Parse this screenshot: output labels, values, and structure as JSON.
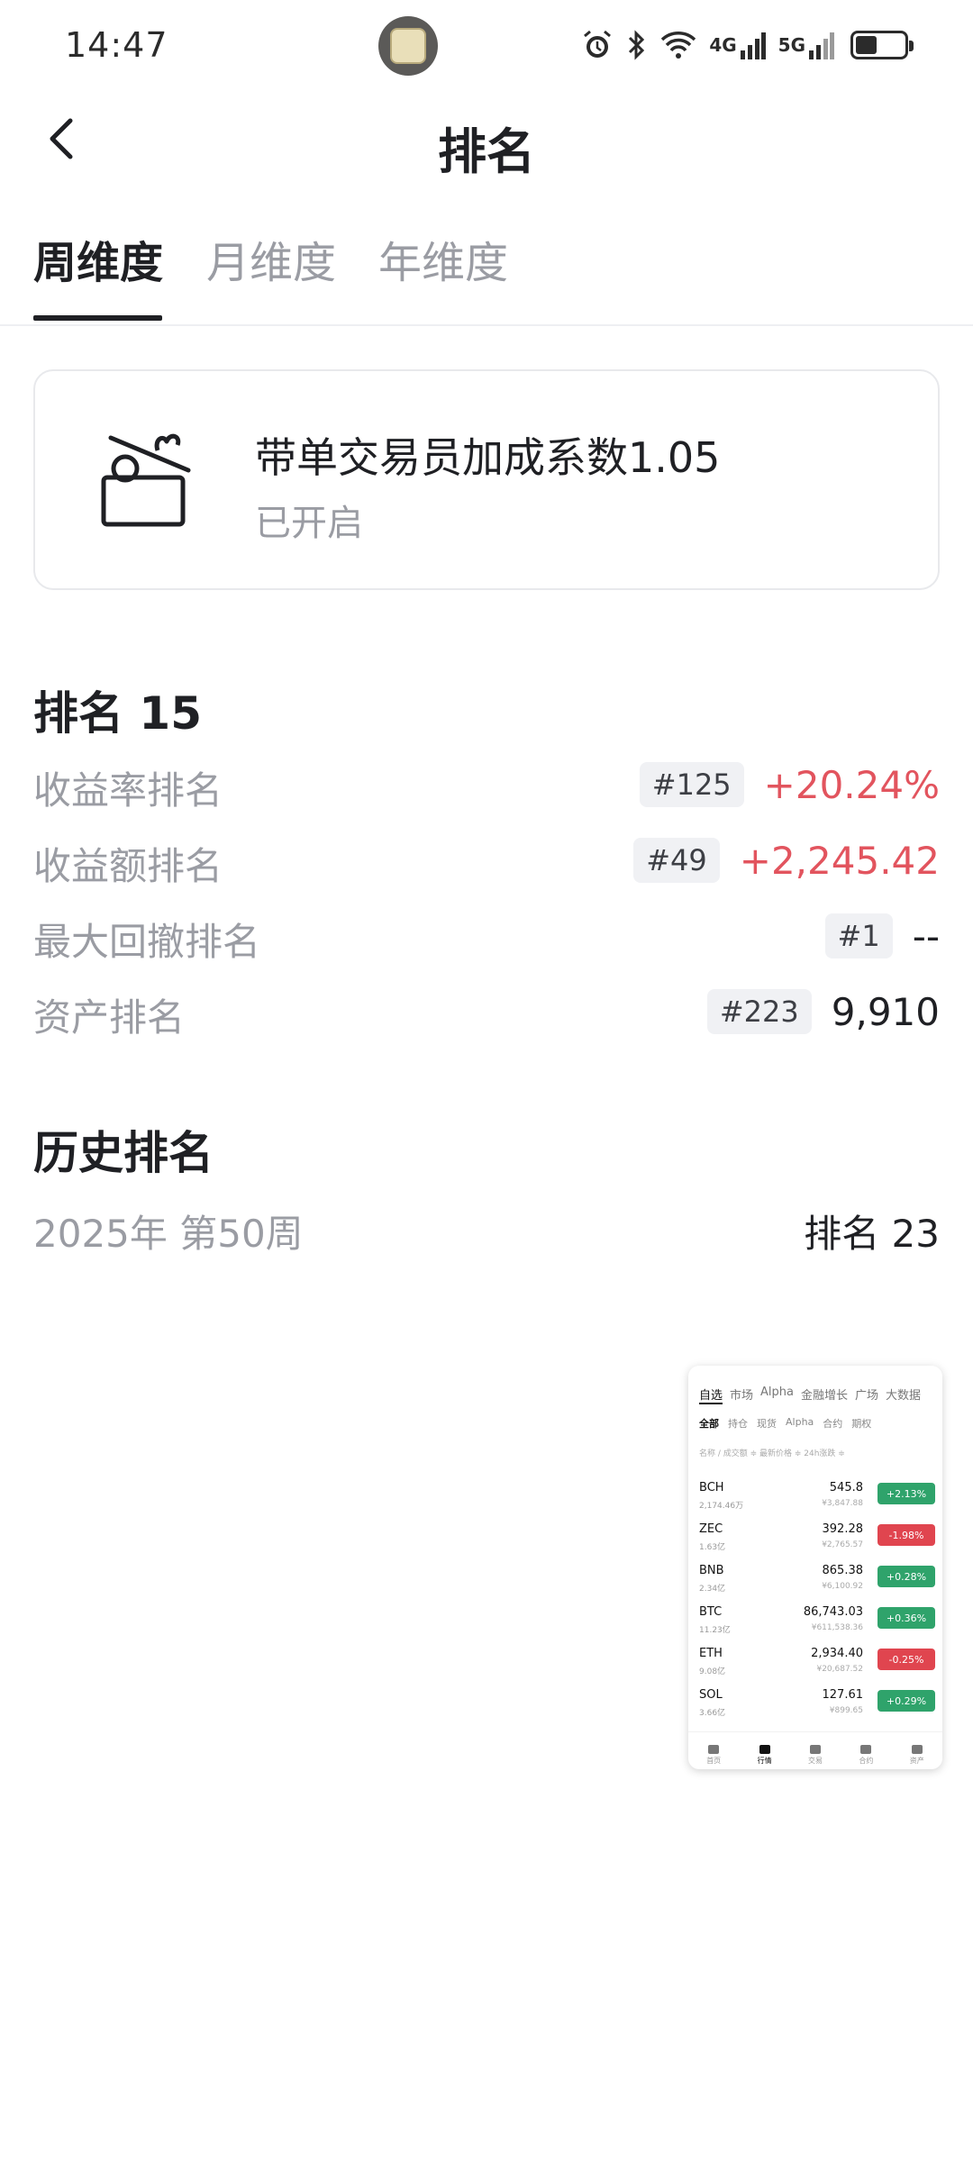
{
  "status_bar": {
    "time": "14:47",
    "network_4g": "4G",
    "network_5g": "5G",
    "icons": [
      "alarm-icon",
      "bluetooth-icon",
      "wifi-icon",
      "signal-4g-icon",
      "signal-5g-icon",
      "battery-icon"
    ],
    "battery_level": 0.45
  },
  "header": {
    "title": "排名"
  },
  "tabs": [
    {
      "label": "周维度",
      "active": true
    },
    {
      "label": "月维度",
      "active": false
    },
    {
      "label": "年维度",
      "active": false
    }
  ],
  "bonus_card": {
    "icon": "gift-box-icon",
    "title": "带单交易员加成系数1.05",
    "status": "已开启"
  },
  "ranking": {
    "heading": "排名 15",
    "metrics": [
      {
        "label": "收益率排名",
        "rank": "#125",
        "value": "+20.24%",
        "trend": "up"
      },
      {
        "label": "收益额排名",
        "rank": "#49",
        "value": "+2,245.42",
        "trend": "up"
      },
      {
        "label": "最大回撤排名",
        "rank": "#1",
        "value": "--",
        "trend": "neutral"
      },
      {
        "label": "资产排名",
        "rank": "#223",
        "value": "9,910",
        "trend": "neutral"
      }
    ]
  },
  "history": {
    "heading": "历史排名",
    "rows": [
      {
        "period": "2025年 第50周",
        "rank": "排名 23"
      }
    ]
  },
  "thumbnail": {
    "nav": [
      "自选",
      "市场",
      "Alpha",
      "金融增长",
      "广场",
      "大数据"
    ],
    "sub_nav": [
      "全部",
      "持仓",
      "现货",
      "Alpha",
      "合约",
      "期权"
    ],
    "header": "名称 / 成交额 ≑    最新价格 ≑     24h涨跌 ≑",
    "rows": [
      {
        "symbol": "BCH",
        "volume": "2,174.46万",
        "price": "545.8",
        "cny": "¥3,847.88",
        "change": "+2.13%",
        "trend": "up"
      },
      {
        "symbol": "ZEC",
        "volume": "1.63亿",
        "price": "392.28",
        "cny": "¥2,765.57",
        "change": "-1.98%",
        "trend": "down"
      },
      {
        "symbol": "BNB",
        "volume": "2.34亿",
        "price": "865.38",
        "cny": "¥6,100.92",
        "change": "+0.28%",
        "trend": "up"
      },
      {
        "symbol": "BTC",
        "volume": "11.23亿",
        "price": "86,743.03",
        "cny": "¥611,538.36",
        "change": "+0.36%",
        "trend": "up"
      },
      {
        "symbol": "ETH",
        "volume": "9.08亿",
        "price": "2,934.40",
        "cny": "¥20,687.52",
        "change": "-0.25%",
        "trend": "down"
      },
      {
        "symbol": "SOL",
        "volume": "3.66亿",
        "price": "127.61",
        "cny": "¥899.65",
        "change": "+0.29%",
        "trend": "up"
      }
    ],
    "tabbar": [
      "首页",
      "行情",
      "交易",
      "合约",
      "资产"
    ],
    "tabbar_active": 1
  },
  "colors": {
    "up": "#e2545e",
    "text_primary": "#1f2024",
    "text_secondary": "#9a9ca3",
    "badge_bg": "#f0f1f4"
  }
}
